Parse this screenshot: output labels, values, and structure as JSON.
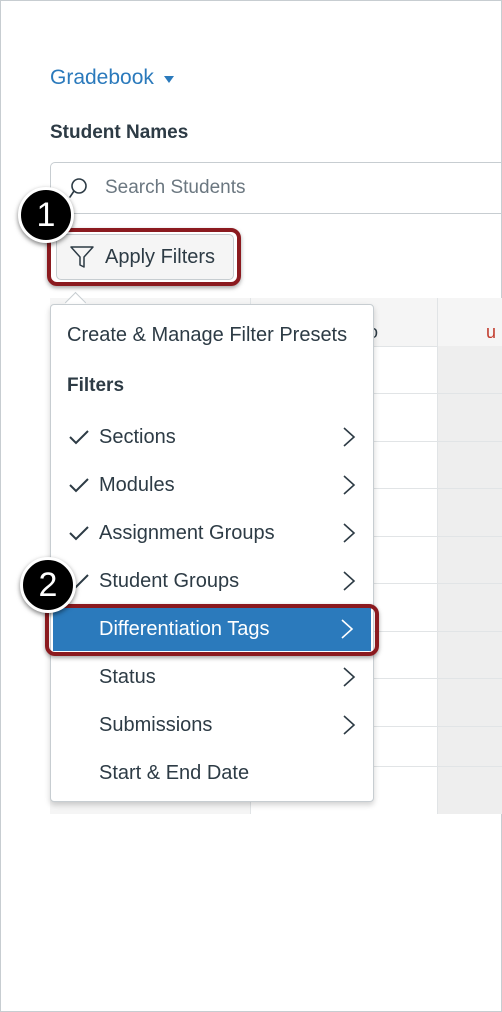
{
  "header": {
    "gradebook_label": "Gradebook",
    "student_names_label": "Student Names"
  },
  "search": {
    "placeholder": "Search Students",
    "value": ""
  },
  "filters_button": {
    "label": "Apply Filters"
  },
  "grid": {
    "header_partial_text": "o",
    "header_partial_red": "u"
  },
  "steps": {
    "step1": "1",
    "step2": "2"
  },
  "menu": {
    "presets_label": "Create & Manage Filter Presets",
    "group_label": "Filters",
    "items": [
      {
        "label": "Sections",
        "checked": true,
        "has_submenu": true
      },
      {
        "label": "Modules",
        "checked": true,
        "has_submenu": true
      },
      {
        "label": "Assignment Groups",
        "checked": true,
        "has_submenu": true
      },
      {
        "label": "Student Groups",
        "checked": true,
        "has_submenu": true
      },
      {
        "label": "Differentiation Tags",
        "checked": false,
        "has_submenu": true,
        "active": true
      },
      {
        "label": "Status",
        "checked": false,
        "has_submenu": true
      },
      {
        "label": "Submissions",
        "checked": false,
        "has_submenu": true
      },
      {
        "label": "Start & End Date",
        "checked": false,
        "has_submenu": false
      }
    ]
  },
  "colors": {
    "accent": "#2b7abc",
    "highlight_border": "#8b1a1f",
    "text": "#2d3b45"
  }
}
